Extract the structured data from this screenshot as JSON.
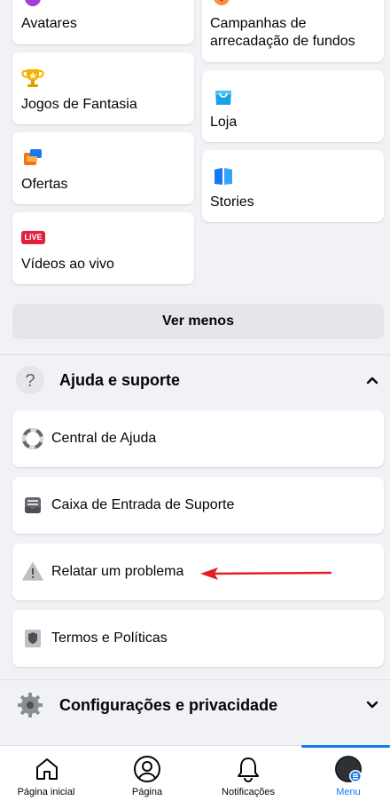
{
  "shortcuts": {
    "left": [
      {
        "label": "Avatares",
        "icon": "avatar-icon"
      },
      {
        "label": "Jogos de Fantasia",
        "icon": "trophy-icon"
      },
      {
        "label": "Ofertas",
        "icon": "offers-icon"
      },
      {
        "label": "Vídeos ao vivo",
        "icon": "live-icon",
        "badge": "LIVE"
      }
    ],
    "right": [
      {
        "label": "Campanhas de arrecadação de fundos",
        "line1": "Campanhas de",
        "line2": "arrecadação de fundos",
        "icon": "fundraiser-icon"
      },
      {
        "label": "Loja",
        "icon": "shop-icon"
      },
      {
        "label": "Stories",
        "icon": "stories-icon"
      }
    ]
  },
  "see_less_label": "Ver menos",
  "help_section": {
    "title": "Ajuda e suporte",
    "items": [
      {
        "label": "Central de Ajuda",
        "icon": "lifebuoy-icon"
      },
      {
        "label": "Caixa de Entrada de Suporte",
        "icon": "inbox-icon"
      },
      {
        "label": "Relatar um problema",
        "icon": "warning-icon"
      },
      {
        "label": "Termos e Políticas",
        "icon": "shield-icon"
      }
    ]
  },
  "settings_section": {
    "title": "Configurações e privacidade"
  },
  "bottom_nav": [
    {
      "label": "Página inicial",
      "icon": "home-icon"
    },
    {
      "label": "Página",
      "icon": "profile-icon"
    },
    {
      "label": "Notificações",
      "icon": "bell-icon"
    },
    {
      "label": "Menu",
      "icon": "menu-avatar-icon",
      "active": true
    }
  ],
  "colors": {
    "accent": "#1877f2",
    "annotation_arrow": "#e41e26"
  }
}
